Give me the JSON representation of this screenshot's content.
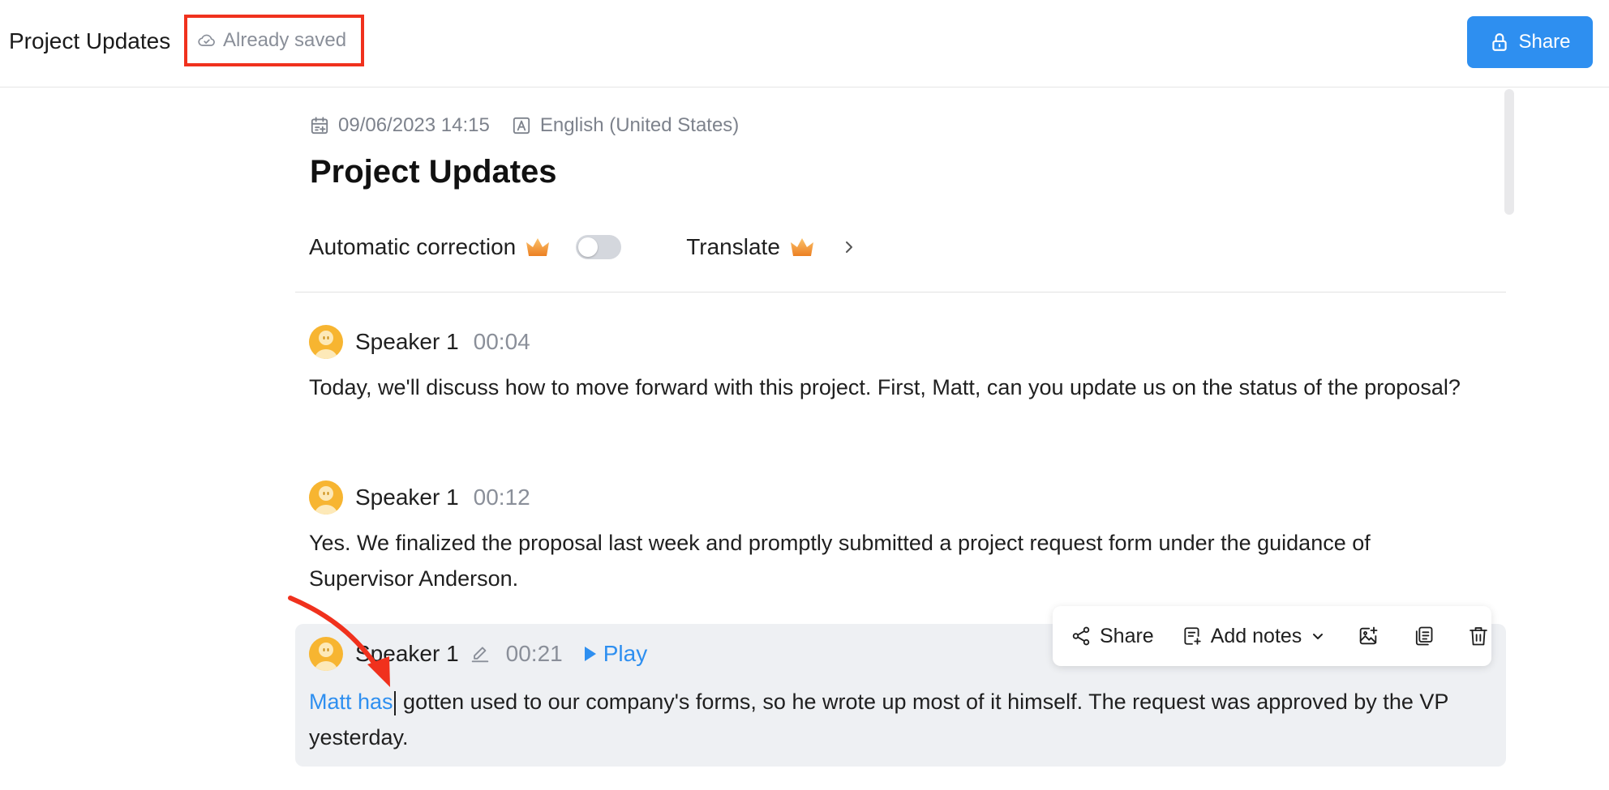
{
  "header": {
    "doc_name": "Project Updates",
    "save_status": "Already saved",
    "share_label": "Share"
  },
  "meta": {
    "datetime": "09/06/2023 14:15",
    "language": "English (United States)"
  },
  "page_title": "Project Updates",
  "options": {
    "auto_correction_label": "Automatic correction",
    "auto_correction_enabled": false,
    "translate_label": "Translate"
  },
  "segments": [
    {
      "speaker": "Speaker 1",
      "time": "00:04",
      "text": "Today, we'll discuss how to move forward with this project. First, Matt, can you update us on the status of the proposal?"
    },
    {
      "speaker": "Speaker 1",
      "time": "00:12",
      "text": "Yes. We finalized the proposal last week and promptly submitted a project request form under the guidance of Supervisor Anderson."
    },
    {
      "speaker": "Speaker 1",
      "time": "00:21",
      "play_label": "Play",
      "highlight_text": "Matt has",
      "text_rest": " gotten used to our company's forms, so he wrote up most of it himself. The request was approved by the VP yesterday."
    }
  ],
  "toolbar": {
    "share_label": "Share",
    "add_notes_label": "Add notes"
  },
  "colors": {
    "accent": "#2e8ff0",
    "annotation": "#f0311d",
    "avatar": "#f7b531",
    "crown": "#f08a2a"
  },
  "icons": [
    "cloud-check-icon",
    "lock-icon",
    "calendar-icon",
    "language-icon",
    "crown-icon",
    "chevron-right-icon",
    "avatar-icon",
    "pencil-icon",
    "play-icon",
    "share-nodes-icon",
    "add-notes-icon",
    "chevron-down-icon",
    "image-icon",
    "copy-icon",
    "trash-icon"
  ]
}
